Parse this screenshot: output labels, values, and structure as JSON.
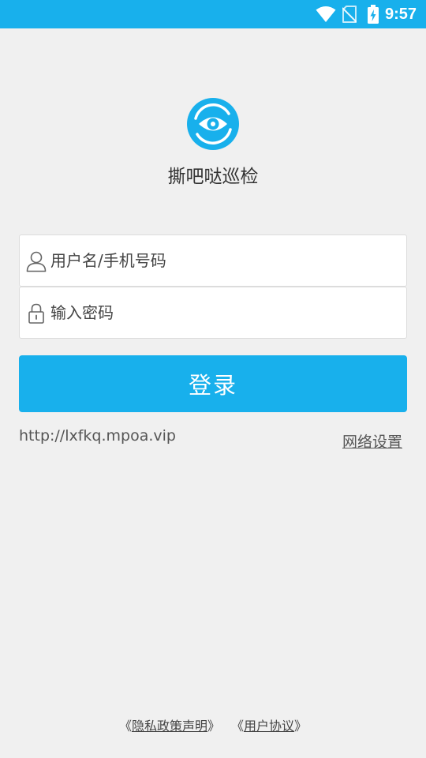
{
  "status_bar": {
    "time": "9:57",
    "icons": [
      "wifi-icon",
      "no-sim-icon",
      "battery-charging-icon"
    ],
    "background": "#18b0ec"
  },
  "app": {
    "title": "撕吧哒巡检",
    "logo_icon": "eye-icon",
    "accent_color": "#18b0ec"
  },
  "login_form": {
    "username": {
      "placeholder": "用户名/手机号码",
      "value": "",
      "icon": "user-icon"
    },
    "password": {
      "placeholder": "输入密码",
      "value": "",
      "icon": "lock-icon"
    },
    "submit_label": "登录"
  },
  "server": {
    "url": "http://lxfkq.mpoa.vip",
    "network_settings_label": "网络设置"
  },
  "footer": {
    "privacy_open": "《",
    "privacy_label": "隐私政策声明",
    "privacy_close": "》",
    "agreement_open": "《",
    "agreement_label": "用户协议",
    "agreement_close": "》"
  }
}
